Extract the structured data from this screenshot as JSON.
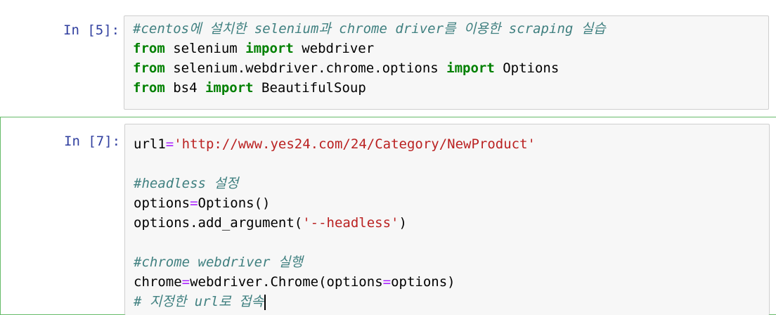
{
  "cells": [
    {
      "prompt": "In [5]:",
      "lines": [
        [
          {
            "t": "#centos에 설치한 selenium과 chrome driver를 이용한 scraping 실습",
            "c": "cm"
          }
        ],
        [
          {
            "t": "from",
            "c": "kw"
          },
          {
            "t": " selenium "
          },
          {
            "t": "import",
            "c": "kw"
          },
          {
            "t": " webdriver"
          }
        ],
        [
          {
            "t": "from",
            "c": "kw"
          },
          {
            "t": " selenium.webdriver.chrome.options "
          },
          {
            "t": "import",
            "c": "kw"
          },
          {
            "t": " Options"
          }
        ],
        [
          {
            "t": "from",
            "c": "kw"
          },
          {
            "t": " bs4 "
          },
          {
            "t": "import",
            "c": "kw"
          },
          {
            "t": " BeautifulSoup"
          }
        ]
      ]
    },
    {
      "prompt": "In [7]:",
      "selected": true,
      "lines": [
        [
          {
            "t": "url1"
          },
          {
            "t": "=",
            "c": "op"
          },
          {
            "t": "'http://www.yes24.com/24/Category/NewProduct'",
            "c": "st"
          }
        ],
        [],
        [
          {
            "t": "#headless 설정",
            "c": "cm"
          }
        ],
        [
          {
            "t": "options"
          },
          {
            "t": "=",
            "c": "op"
          },
          {
            "t": "Options()"
          }
        ],
        [
          {
            "t": "options.add_argument("
          },
          {
            "t": "'--headless'",
            "c": "st"
          },
          {
            "t": ")"
          }
        ],
        [],
        [
          {
            "t": "#chrome webdriver 실행",
            "c": "cm"
          }
        ],
        [
          {
            "t": "chrome"
          },
          {
            "t": "=",
            "c": "op"
          },
          {
            "t": "webdriver.Chrome(options"
          },
          {
            "t": "=",
            "c": "op"
          },
          {
            "t": "options)"
          }
        ],
        [
          {
            "t": "# 지정한 url로 접속",
            "c": "cm"
          }
        ]
      ]
    }
  ],
  "colors": {
    "prompt": "#303f9f",
    "comment": "#408080",
    "keyword": "#008000",
    "string": "#ba2121",
    "operator": "#aa22ff",
    "selected_border": "#66bb6a"
  }
}
